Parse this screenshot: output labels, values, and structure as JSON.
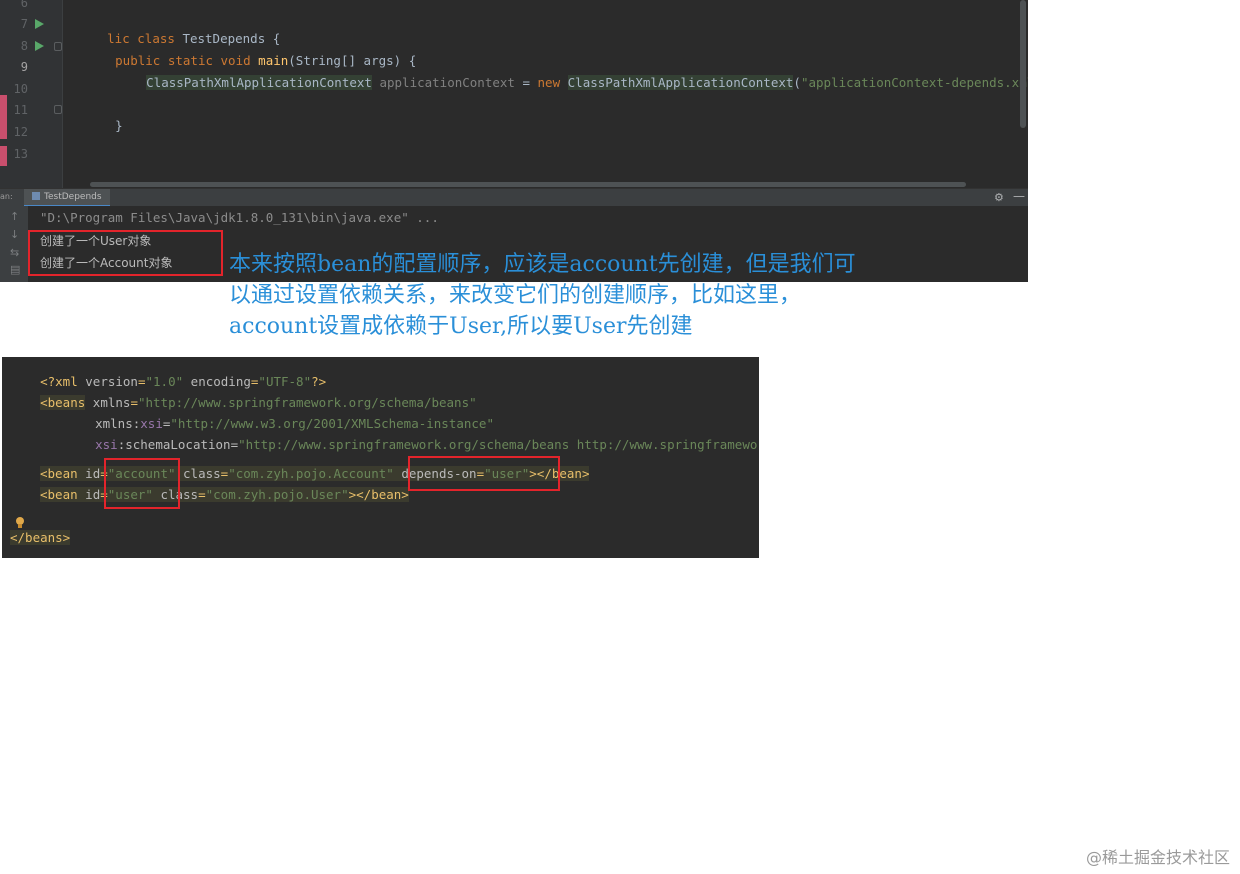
{
  "editor": {
    "line_numbers": [
      "6",
      "7",
      "8",
      "9",
      "10",
      "11",
      "12",
      "13"
    ],
    "line7": {
      "kw1": "lic",
      "kw2": "class",
      "name": "TestDepends",
      "brace": "{"
    },
    "line8": {
      "kw1": "public",
      "kw2": "static",
      "kw3": "void",
      "fn": "main",
      "params": "(String[] args) {"
    },
    "line9": {
      "type": "ClassPathXmlApplicationContext",
      "var": "applicationContext",
      "eq": "=",
      "kw": "new",
      "ctor": "ClassPathXmlApplicationContext",
      "paren": "(",
      "arg": "\"applicationContext-depends.xml\""
    },
    "line11": {
      "brace": "}"
    }
  },
  "run_panel": {
    "side_label": "an:",
    "tab_title": "TestDepends",
    "settings_icon": "gear-icon",
    "minimize_icon": "minus-icon",
    "gutter_icons": [
      "arrow-up-icon",
      "arrow-down-icon",
      "wrap-icon",
      "print-icon"
    ],
    "command": "\"D:\\Program Files\\Java\\jdk1.8.0_131\\bin\\java.exe\" ...",
    "output": [
      "创建了一个User对象",
      "创建了一个Account对象"
    ]
  },
  "annotation": {
    "lines": [
      "本来按照bean的配置顺序，应该是account先创建，但是我们可",
      "以通过设置依赖关系，来改变它们的创建顺序，比如这里，",
      "account设置成依赖于User,所以要User先创建"
    ],
    "color": "#2a8fd8"
  },
  "xml": {
    "decl": {
      "open": "<?xml",
      "v_attr": "version",
      "v_val": "\"1.0\"",
      "e_attr": "encoding",
      "e_val": "\"UTF-8\"",
      "close": "?>"
    },
    "beans_open": {
      "tag": "<beans",
      "attr": "xmlns",
      "val": "\"http://www.springframework.org/schema/beans\""
    },
    "xsi": {
      "attr_a": "xmlns:",
      "attr_b": "xsi",
      "eq": "=",
      "val": "\"http://www.w3.org/2001/XMLSchema-instance\""
    },
    "schema": {
      "attr_a": "xsi",
      "attr_b": ":schemaLocation",
      "eq": "=",
      "val": "\"http://www.springframework.org/schema/beans http://www.springframework.org/schema/beans/spring-beans.xsd\""
    },
    "bean1": {
      "open": "<bean",
      "id_attr": "id",
      "id_val": "\"account\"",
      "class_attr": "class",
      "class_val": "\"com.zyh.pojo.Account\"",
      "dep_attr": "depends-on",
      "dep_val": "\"user\"",
      "gt": ">",
      "close": "</bean>"
    },
    "bean2": {
      "open": "<bean",
      "id_attr": "id",
      "id_val": "\"user\"",
      "class_attr": "class",
      "class_val": "\"com.zyh.pojo.User\"",
      "gt": ">",
      "close": "</bean>"
    },
    "beans_close": "</beans>",
    "bulb_icon": "lightbulb-icon"
  },
  "watermark": "@稀土掘金技术社区"
}
